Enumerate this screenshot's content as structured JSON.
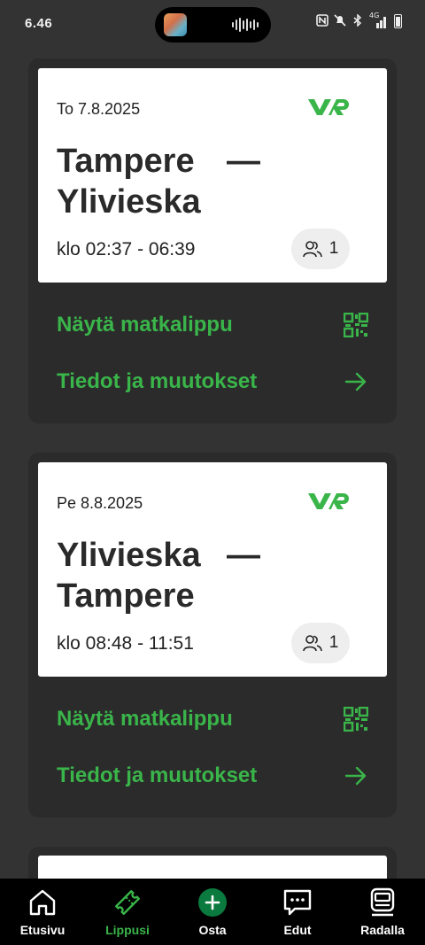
{
  "status_bar": {
    "time": "6.46",
    "network": "4G",
    "icons": [
      "nfc-icon",
      "mute-icon",
      "bluetooth-icon",
      "signal-icon",
      "battery-icon"
    ]
  },
  "brand": {
    "logo_text": "VR",
    "accent_color": "#3ab54a"
  },
  "tickets": [
    {
      "date": "To 7.8.2025",
      "from": "Tampere",
      "to": "Ylivieska",
      "dash": "—",
      "time": "klo 02:37 - 06:39",
      "passengers": "1",
      "show_ticket_label": "Näytä matkalippu",
      "details_label": "Tiedot ja muutokset"
    },
    {
      "date": "Pe 8.8.2025",
      "from": "Ylivieska",
      "to": "Tampere",
      "dash": "—",
      "time": "klo 08:48 - 11:51",
      "passengers": "1",
      "show_ticket_label": "Näytä matkalippu",
      "details_label": "Tiedot ja muutokset"
    }
  ],
  "bottom_nav": {
    "items": [
      {
        "label": "Etusivu",
        "icon": "home-icon",
        "active": false
      },
      {
        "label": "Lippusi",
        "icon": "ticket-icon",
        "active": true
      },
      {
        "label": "Osta",
        "icon": "plus-circle-icon",
        "active": false
      },
      {
        "label": "Edut",
        "icon": "chat-icon",
        "active": false
      },
      {
        "label": "Radalla",
        "icon": "train-icon",
        "active": false
      }
    ]
  }
}
